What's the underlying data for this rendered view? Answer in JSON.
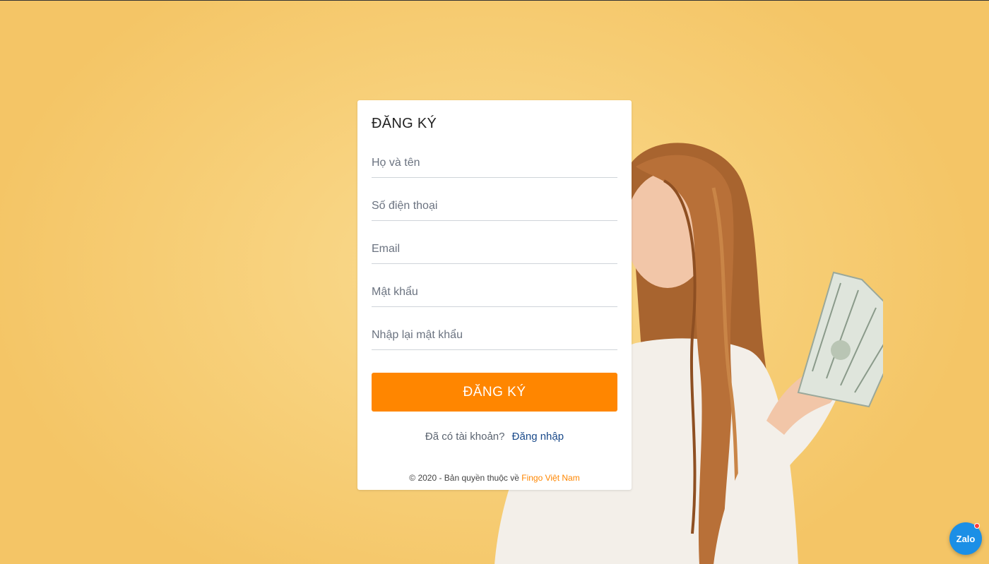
{
  "form": {
    "title": "ĐĂNG KÝ",
    "fields": [
      {
        "name": "fullname",
        "placeholder": "Họ và tên",
        "value": ""
      },
      {
        "name": "phone",
        "placeholder": "Số điện thoại",
        "value": ""
      },
      {
        "name": "email",
        "placeholder": "Email",
        "value": ""
      },
      {
        "name": "password",
        "placeholder": "Mật khẩu",
        "value": ""
      },
      {
        "name": "confirm-password",
        "placeholder": "Nhập lại mật khẩu",
        "value": ""
      }
    ],
    "submit_label": "ĐĂNG KÝ",
    "have_account_text": "Đã có tài khoản?",
    "login_link": "Đăng nhập",
    "copyright_prefix": "© 2020 - Bản quyền thuộc về",
    "brand": "Fingo Việt Nam"
  },
  "zalo_widget": {
    "label": "Zalo",
    "icon": "zalo-chat-icon"
  },
  "colors": {
    "background": "#f8d27f",
    "accent": "#ff8600",
    "link": "#1a4a8a",
    "zalo": "#1b8fe6"
  }
}
